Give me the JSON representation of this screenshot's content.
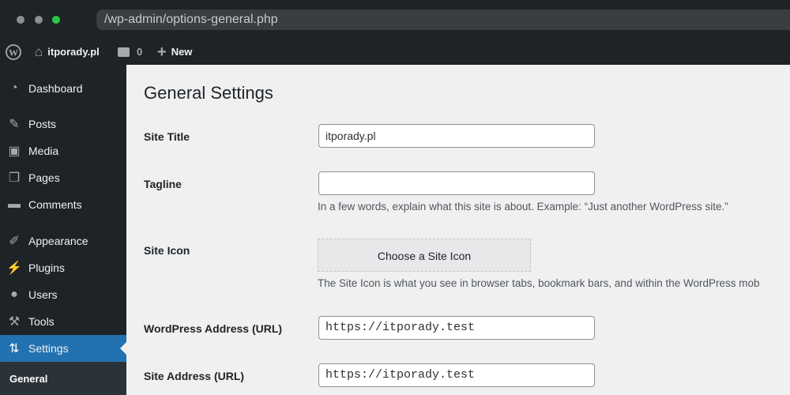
{
  "browser": {
    "url": "/wp-admin/options-general.php",
    "colors": {
      "dot1": "#8e8f93",
      "dot2": "#8e8f93",
      "dot3": "#2ac845"
    }
  },
  "adminbar": {
    "logo": "wordpress-icon",
    "site_name": "itporady.pl",
    "comments_count": "0",
    "new_label": "New"
  },
  "sidebar": {
    "items": [
      {
        "label": "Dashboard",
        "icon": "dashboard-icon"
      },
      {
        "label": "Posts",
        "icon": "pin-icon"
      },
      {
        "label": "Media",
        "icon": "media-icon"
      },
      {
        "label": "Pages",
        "icon": "pages-icon"
      },
      {
        "label": "Comments",
        "icon": "comment-icon"
      },
      {
        "label": "Appearance",
        "icon": "brush-icon"
      },
      {
        "label": "Plugins",
        "icon": "plugin-icon"
      },
      {
        "label": "Users",
        "icon": "user-icon"
      },
      {
        "label": "Tools",
        "icon": "wrench-icon"
      },
      {
        "label": "Settings",
        "icon": "settings-icon",
        "active": true
      }
    ],
    "submenu_active": "General",
    "accent": "#2271b1"
  },
  "main": {
    "title": "General Settings",
    "site_title": {
      "label": "Site Title",
      "value": "itporady.pl"
    },
    "tagline": {
      "label": "Tagline",
      "value": "",
      "description": "In a few words, explain what this site is about. Example: “Just another WordPress site.”"
    },
    "site_icon": {
      "label": "Site Icon",
      "button": "Choose a Site Icon",
      "description": "The Site Icon is what you see in browser tabs, bookmark bars, and within the WordPress mob"
    },
    "wp_address": {
      "label": "WordPress Address (URL)",
      "value": "https://itporady.test"
    },
    "site_address": {
      "label": "Site Address (URL)",
      "value": "https://itporady.test"
    }
  }
}
